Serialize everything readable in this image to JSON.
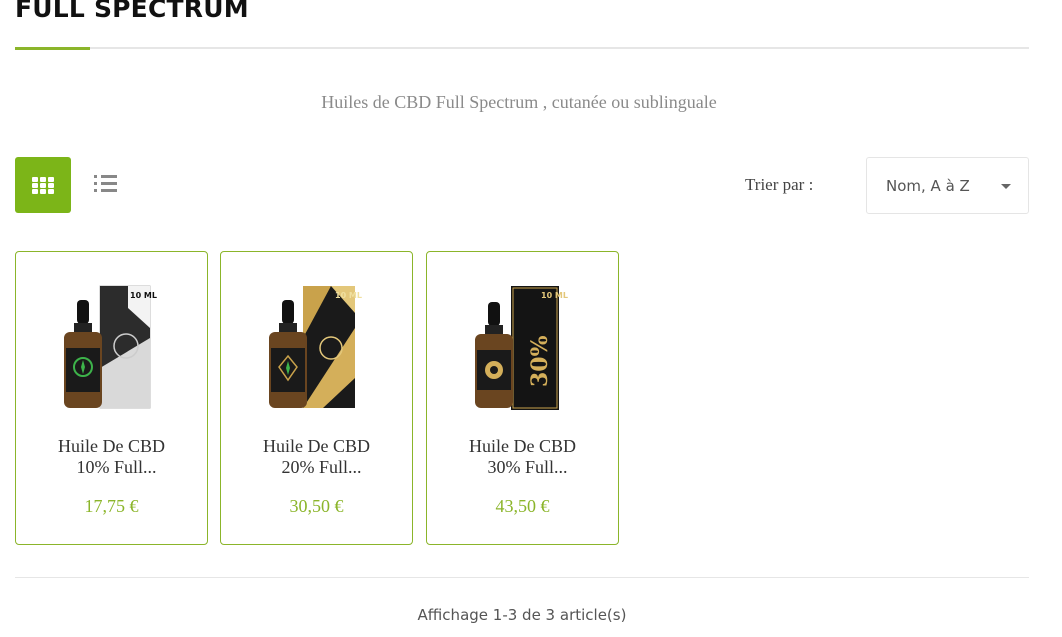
{
  "category": {
    "title": "FULL SPECTRUM",
    "description": "Huiles de CBD Full Spectrum , cutanée ou sublinguale"
  },
  "toolbar": {
    "grid_view_icon": "grid-icon",
    "list_view_icon": "list-icon",
    "active_view": "grid",
    "sort_label": "Trier par :",
    "sort_value": "Nom, A à Z"
  },
  "colors": {
    "accent": "#7cb518",
    "price": "#8bb52a",
    "card_border": "#8bb52a"
  },
  "products": [
    {
      "name_line1": "Huile De CBD",
      "name_line2": "10% Full...",
      "price": "17,75 €",
      "box_label": "10 ML",
      "box_color": "silver",
      "percent_mark": ""
    },
    {
      "name_line1": "Huile De CBD",
      "name_line2": "20% Full...",
      "price": "30,50 €",
      "box_label": "10 ML",
      "box_color": "gold",
      "percent_mark": ""
    },
    {
      "name_line1": "Huile De CBD",
      "name_line2": "30% Full...",
      "price": "43,50 €",
      "box_label": "10 ML",
      "box_color": "black-gold",
      "percent_mark": "30%"
    }
  ],
  "pagination": {
    "summary": "Affichage 1-3 de 3 article(s)"
  }
}
